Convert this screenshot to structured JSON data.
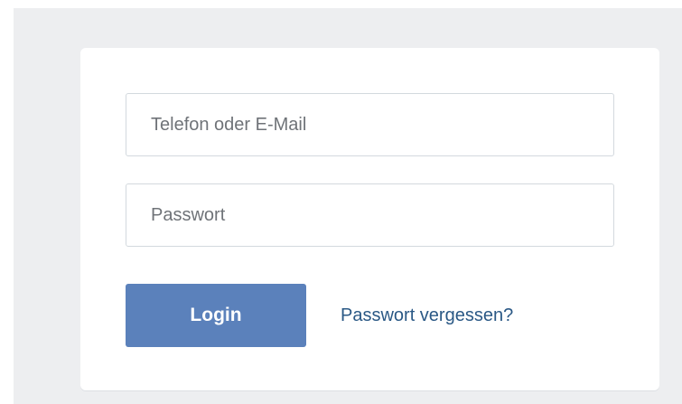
{
  "login_form": {
    "phone_email_placeholder": "Telefon oder E-Mail",
    "password_placeholder": "Passwort",
    "login_button_label": "Login",
    "forgot_password_label": "Passwort vergessen?"
  },
  "colors": {
    "page_background": "#edeef0",
    "card_background": "#ffffff",
    "button_background": "#5b81bb",
    "link_color": "#2a5885",
    "field_border": "#d3d9de"
  }
}
